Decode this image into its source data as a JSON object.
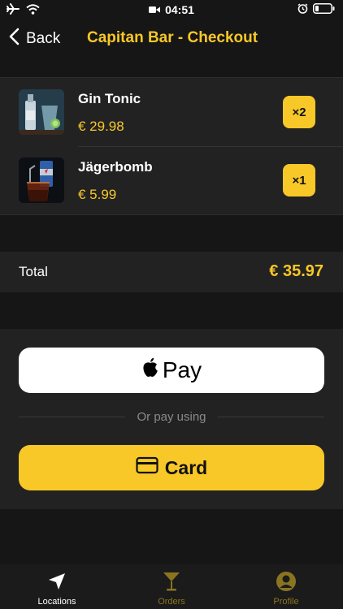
{
  "status_bar": {
    "time": "04:51"
  },
  "nav": {
    "back_label": "Back",
    "title": "Capitan Bar - Checkout"
  },
  "cart": {
    "items": [
      {
        "name": "Gin Tonic",
        "price": "€ 29.98",
        "quantity": "×2"
      },
      {
        "name": "Jägerbomb",
        "price": "€ 5.99",
        "quantity": "×1"
      }
    ]
  },
  "total": {
    "label": "Total",
    "value": "€ 35.97"
  },
  "payment": {
    "apple_pay_label": "Pay",
    "separator_text": "Or pay using",
    "card_label": "Card"
  },
  "tabs": [
    {
      "label": "Locations",
      "icon": "location-arrow-icon",
      "active": true
    },
    {
      "label": "Orders",
      "icon": "cocktail-glass-icon",
      "active": false
    },
    {
      "label": "Profile",
      "icon": "profile-icon",
      "active": false
    }
  ],
  "colors": {
    "accent": "#f8c828",
    "background": "#161616",
    "surface": "#222222",
    "inactive_tab": "#8a7420"
  }
}
